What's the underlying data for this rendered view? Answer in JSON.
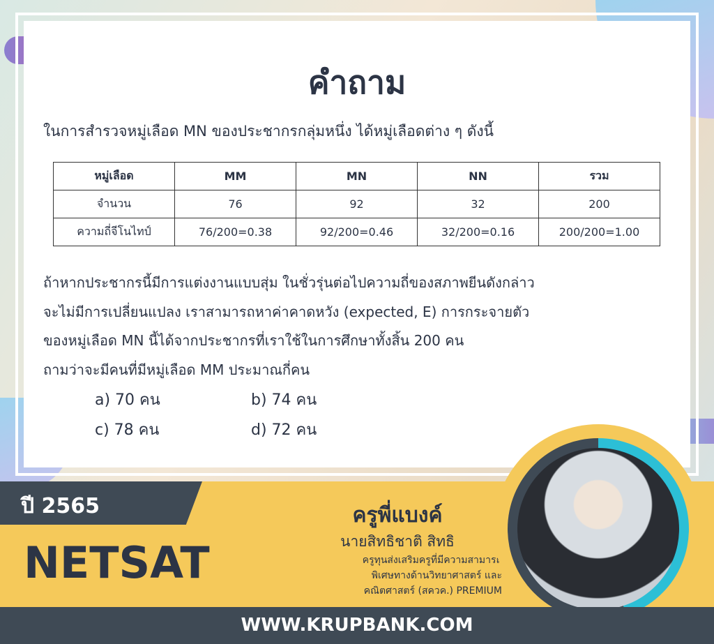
{
  "title": "คำถาม",
  "intro": "ในการสำรวจหมู่เลือด MN ของประชากรกลุ่มหนึ่ง ได้หมู่เลือดต่าง ๆ ดังนี้",
  "table": {
    "header": [
      "หมู่เลือด",
      "MM",
      "MN",
      "NN",
      "รวม"
    ],
    "rows": [
      [
        "จำนวน",
        "76",
        "92",
        "32",
        "200"
      ],
      [
        "ความถี่จีโนไทป์",
        "76/200=0.38",
        "92/200=0.46",
        "32/200=0.16",
        "200/200=1.00"
      ]
    ]
  },
  "paragraph": [
    "ถ้าหากประชากรนี้มีการแต่งงานแบบสุ่ม ในชั่วรุ่นต่อไปความถี่ของสภาพยีนดังกล่าว",
    "จะไม่มีการเปลี่ยนแปลง เราสามารถหาค่าคาดหวัง (expected, E) การกระจายตัว",
    "ของหมู่เลือด MN นี้ได้จากประชากรที่เราใช้ในการศึกษาทั้งสิ้น 200 คน",
    "ถามว่าจะมีคนที่มีหมู่เลือด MM ประมาณกี่คน"
  ],
  "options": {
    "a": "a) 70 คน",
    "b": "b) 74 คน",
    "c": "c) 78 คน",
    "d": "d) 72 คน"
  },
  "year": "ปี 2565",
  "exam": "NETSAT",
  "teacher": {
    "nickname": "ครูพี่แบงค์",
    "name": "นายสิทธิชาติ สิทธิ",
    "desc": [
      "ครูทุนส่งเสริมครูที่มีความสามารถ",
      "พิเศษทางด้านวิทยาศาสตร์ และ",
      "คณิตศาสตร์ (สควค.) PREMIUM"
    ]
  },
  "website": "WWW.KRUPBANK.COM",
  "colors": {
    "accent": "#f5c95a",
    "dark": "#3f4a55",
    "ring": "#2cbfd6"
  }
}
